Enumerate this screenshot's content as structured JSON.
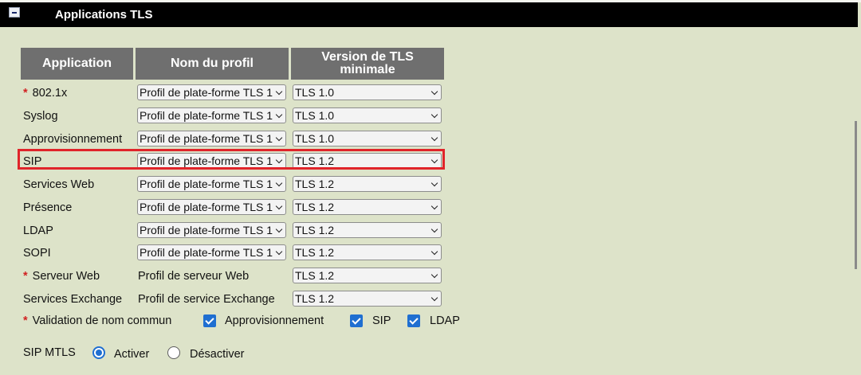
{
  "section": {
    "title": "Applications TLS"
  },
  "table": {
    "headers": {
      "application": "Application",
      "profile": "Nom du profil",
      "tls": "Version de TLS minimale"
    },
    "rows": [
      {
        "application": "802.1x",
        "required": true,
        "profile": "Profil de plate-forme TLS 1",
        "profile_is_select": true,
        "tls": "TLS 1.0"
      },
      {
        "application": "Syslog",
        "required": false,
        "profile": "Profil de plate-forme TLS 1",
        "profile_is_select": true,
        "tls": "TLS 1.0"
      },
      {
        "application": "Approvisionnement",
        "required": false,
        "profile": "Profil de plate-forme TLS 1",
        "profile_is_select": true,
        "tls": "TLS 1.0"
      },
      {
        "application": "SIP",
        "required": false,
        "profile": "Profil de plate-forme TLS 1",
        "profile_is_select": true,
        "tls": "TLS 1.2",
        "highlighted": true
      },
      {
        "application": "Services Web",
        "required": false,
        "profile": "Profil de plate-forme TLS 1",
        "profile_is_select": true,
        "tls": "TLS 1.2"
      },
      {
        "application": "Présence",
        "required": false,
        "profile": "Profil de plate-forme TLS 1",
        "profile_is_select": true,
        "tls": "TLS 1.2"
      },
      {
        "application": "LDAP",
        "required": false,
        "profile": "Profil de plate-forme TLS 1",
        "profile_is_select": true,
        "tls": "TLS 1.2"
      },
      {
        "application": "SOPI",
        "required": false,
        "profile": "Profil de plate-forme TLS 1",
        "profile_is_select": true,
        "tls": "TLS 1.2"
      },
      {
        "application": "Serveur Web",
        "required": true,
        "profile": "Profil de serveur Web",
        "profile_is_select": false,
        "tls": "TLS 1.2"
      },
      {
        "application": "Services Exchange",
        "required": false,
        "profile": "Profil de service Exchange",
        "profile_is_select": false,
        "tls": "TLS 1.2"
      }
    ]
  },
  "validation": {
    "label": "Validation de nom commun",
    "required": true,
    "options": [
      {
        "label": "Approvisionnement",
        "checked": true
      },
      {
        "label": "SIP",
        "checked": true
      },
      {
        "label": "LDAP",
        "checked": true
      }
    ]
  },
  "sip_mtls": {
    "label": "SIP MTLS",
    "options": [
      {
        "label": "Activer",
        "selected": true
      },
      {
        "label": "Désactiver",
        "selected": false
      }
    ]
  },
  "colors": {
    "background": "#dde3c9",
    "header_bar": "#000000",
    "table_header": "#6f6f6f",
    "required_star": "#d12121",
    "highlight_border": "#e0242a",
    "control_accent": "#1f6fd1"
  }
}
